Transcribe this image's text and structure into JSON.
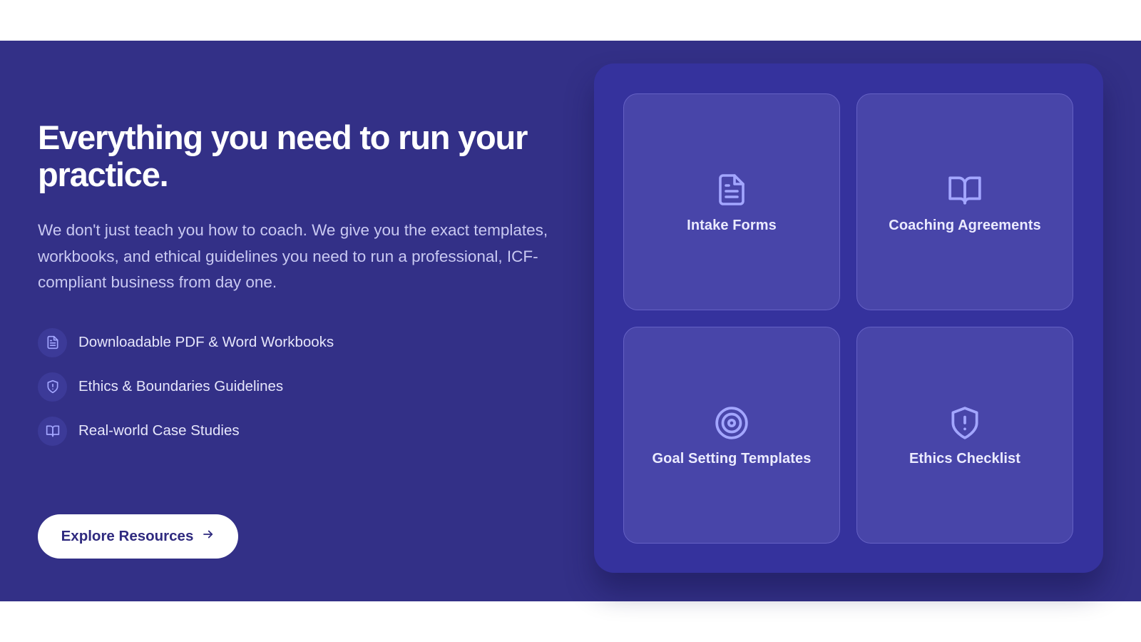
{
  "hero": {
    "headline": "Everything you need to run your practice.",
    "description": "We don't just teach you how to coach. We give you the exact templates, workbooks, and ethical guidelines you need to run a professional, ICF-compliant business from day one.",
    "features": [
      {
        "icon": "document-icon",
        "label": "Downloadable PDF & Word Workbooks"
      },
      {
        "icon": "shield-icon",
        "label": "Ethics & Boundaries Guidelines"
      },
      {
        "icon": "open-book-icon",
        "label": "Real-world Case Studies"
      }
    ],
    "cta_label": "Explore Resources",
    "cta_icon": "arrow-right-icon"
  },
  "resources": {
    "cards": [
      {
        "icon": "document-icon",
        "label": "Intake Forms"
      },
      {
        "icon": "open-book-icon",
        "label": "Coaching Agreements"
      },
      {
        "icon": "target-icon",
        "label": "Goal Setting Templates"
      },
      {
        "icon": "shield-alert-icon",
        "label": "Ethics Checklist"
      }
    ]
  },
  "colors": {
    "section_background": "#333087",
    "panel_background": "#35329d",
    "card_background": "#4845a9",
    "icon_accent": "#a3a6ff",
    "button_text": "#2f2a7f"
  }
}
